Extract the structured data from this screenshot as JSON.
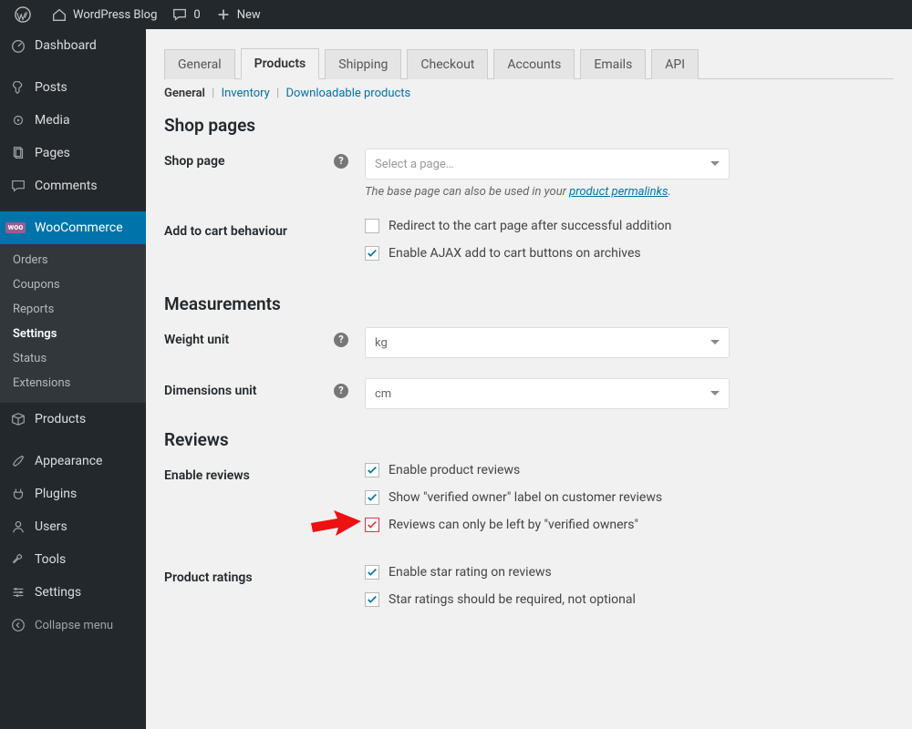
{
  "adminbar": {
    "site_title": "WordPress Blog",
    "comments_count": "0",
    "new_label": "New"
  },
  "sidebar": {
    "items": [
      {
        "id": "dashboard",
        "label": "Dashboard",
        "icon": "gauge"
      },
      {
        "id": "posts",
        "label": "Posts",
        "icon": "pin"
      },
      {
        "id": "media",
        "label": "Media",
        "icon": "media"
      },
      {
        "id": "pages",
        "label": "Pages",
        "icon": "pages"
      },
      {
        "id": "comments",
        "label": "Comments",
        "icon": "comment"
      },
      {
        "id": "woocommerce",
        "label": "WooCommerce",
        "icon": "woo",
        "current": true
      },
      {
        "id": "products",
        "label": "Products",
        "icon": "box"
      },
      {
        "id": "appearance",
        "label": "Appearance",
        "icon": "brush"
      },
      {
        "id": "plugins",
        "label": "Plugins",
        "icon": "plug"
      },
      {
        "id": "users",
        "label": "Users",
        "icon": "user"
      },
      {
        "id": "tools",
        "label": "Tools",
        "icon": "wrench"
      },
      {
        "id": "settings",
        "label": "Settings",
        "icon": "sliders"
      }
    ],
    "woo_submenu": [
      "Orders",
      "Coupons",
      "Reports",
      "Settings",
      "Status",
      "Extensions"
    ],
    "woo_submenu_current": "Settings",
    "collapse_label": "Collapse menu"
  },
  "tabs": {
    "items": [
      "General",
      "Products",
      "Shipping",
      "Checkout",
      "Accounts",
      "Emails",
      "API"
    ],
    "active": "Products"
  },
  "subtabs": {
    "items": [
      "General",
      "Inventory",
      "Downloadable products"
    ],
    "active": "General"
  },
  "sections": {
    "shop_pages": {
      "title": "Shop pages",
      "shop_page_label": "Shop page",
      "shop_page_placeholder": "Select a page…",
      "shop_page_desc_prefix": "The base page can also be used in your ",
      "shop_page_desc_link": "product permalinks",
      "shop_page_desc_suffix": ".",
      "add_to_cart_label": "Add to cart behaviour",
      "cb_redirect": "Redirect to the cart page after successful addition",
      "cb_ajax": "Enable AJAX add to cart buttons on archives"
    },
    "measurements": {
      "title": "Measurements",
      "weight_unit_label": "Weight unit",
      "weight_unit_value": "kg",
      "dimensions_unit_label": "Dimensions unit",
      "dimensions_unit_value": "cm"
    },
    "reviews": {
      "title": "Reviews",
      "enable_reviews_label": "Enable reviews",
      "cb_enable_product_reviews": "Enable product reviews",
      "cb_show_verified_label": "Show \"verified owner\" label on customer reviews",
      "cb_only_verified": "Reviews can only be left by \"verified owners\"",
      "product_ratings_label": "Product ratings",
      "cb_enable_star": "Enable star rating on reviews",
      "cb_star_required": "Star ratings should be required, not optional"
    }
  }
}
